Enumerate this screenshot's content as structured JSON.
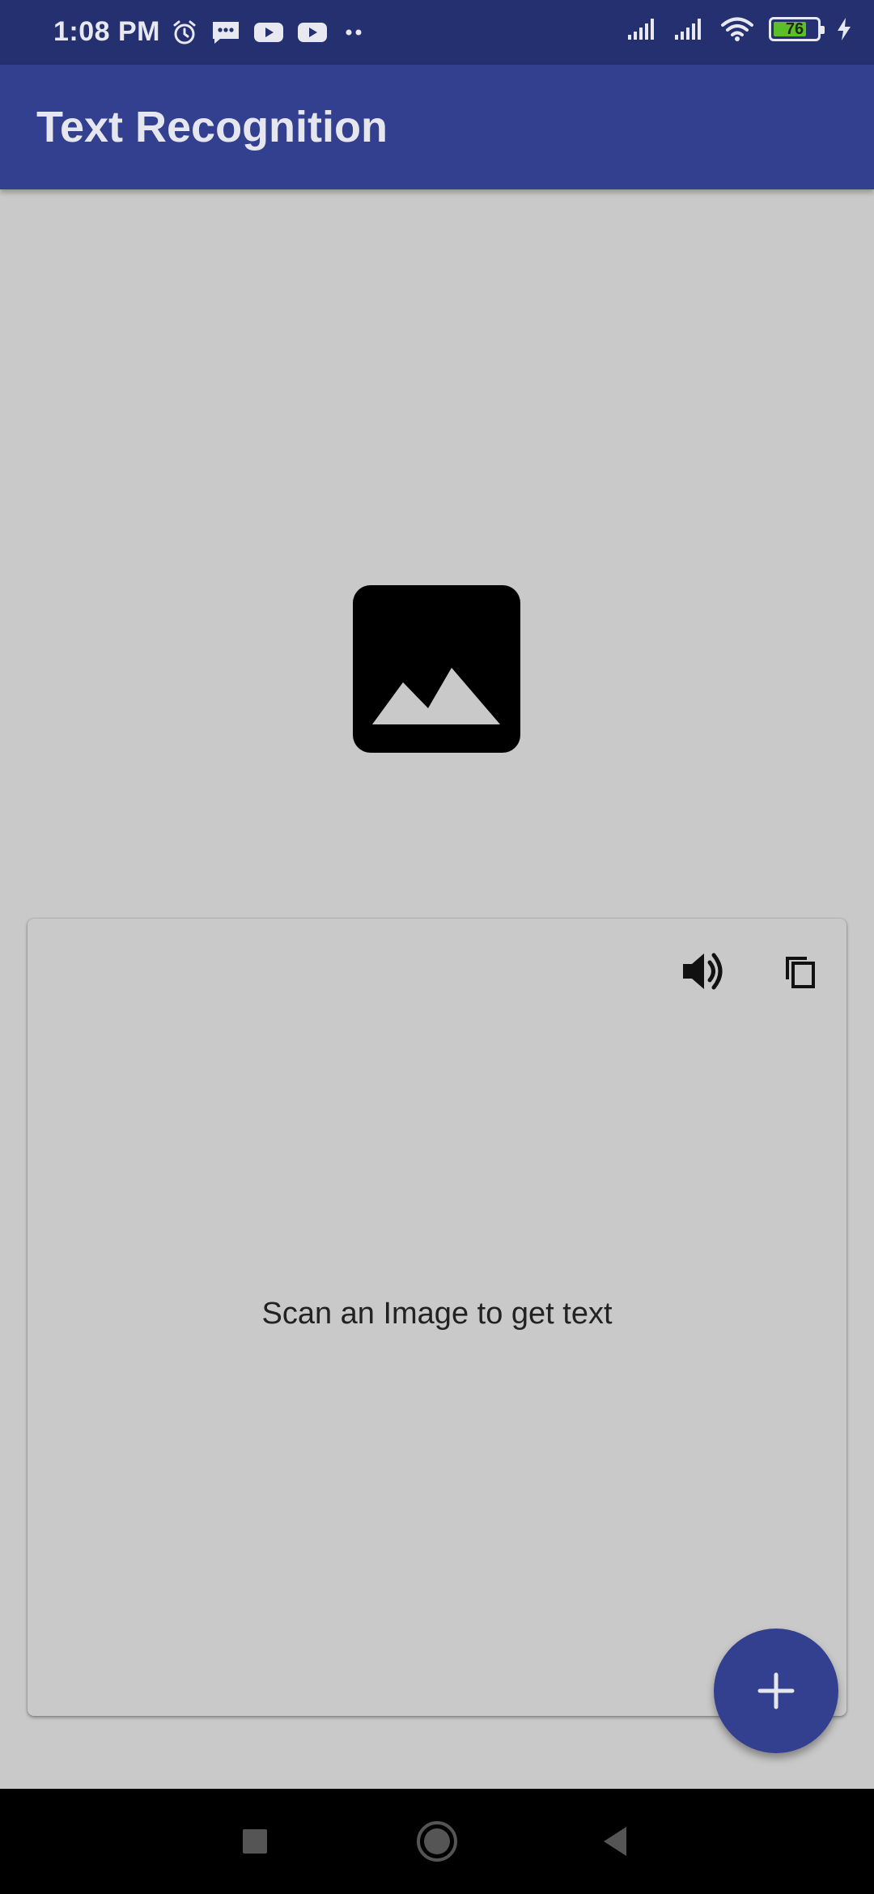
{
  "status_bar": {
    "time": "1:08 PM",
    "battery_level": "76",
    "battery_fraction": 0.76,
    "left_icons": [
      "alarm-icon",
      "message-icon",
      "youtube-icon",
      "youtube-icon",
      "more-dots-icon"
    ],
    "right_icons": [
      "signal-icon",
      "signal-icon",
      "wifi-icon",
      "battery-icon",
      "charging-icon"
    ]
  },
  "app_bar": {
    "title": "Text Recognition"
  },
  "main": {
    "image_placeholder_icon": "image-icon",
    "card": {
      "speak_icon": "volume-icon",
      "copy_icon": "copy-icon",
      "result_text": "Scan an Image to get text"
    },
    "fab_icon": "plus-icon"
  },
  "nav_bar": {
    "buttons": [
      "recents-square-icon",
      "home-circle-icon",
      "back-triangle-icon"
    ]
  },
  "colors": {
    "status_bar": "#24306f",
    "app_bar": "#32408f",
    "background": "#c9c9c9",
    "fab": "#32408f",
    "battery_fill": "#5cbf2a"
  }
}
